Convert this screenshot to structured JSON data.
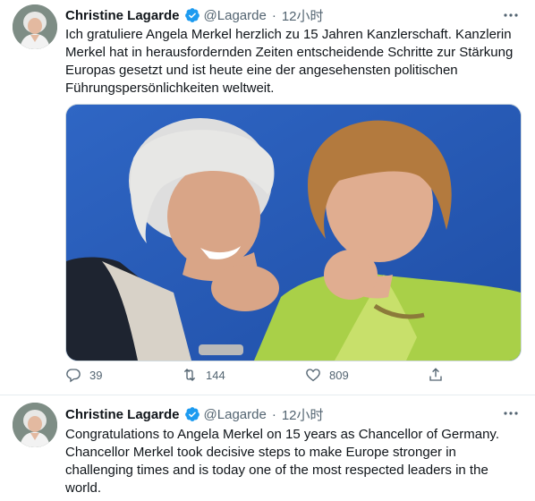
{
  "tweets": [
    {
      "name": "Christine Lagarde",
      "handle": "@Lagarde",
      "dot": "·",
      "time": "12小时",
      "text": "Ich gratuliere Angela Merkel herzlich zu 15 Jahren Kanzlerschaft. Kanzlerin Merkel hat in herausfordernden Zeiten entscheidende Schritte zur Stärkung Europas gesetzt und ist heute eine der angesehensten politischen Führungspersönlichkeiten weltweit.",
      "replies": "39",
      "retweets": "144",
      "likes": "809"
    },
    {
      "name": "Christine Lagarde",
      "handle": "@Lagarde",
      "dot": "·",
      "time": "12小时",
      "text": "Congratulations to Angela Merkel on 15 years as Chancellor of Germany. Chancellor Merkel took decisive steps to make Europe stronger in challenging times and is today one of the most respected leaders in the world."
    }
  ],
  "icons": {
    "verified": "verified-badge-icon",
    "more": "more-horizontal-icon",
    "reply": "reply-icon",
    "retweet": "retweet-icon",
    "like": "like-heart-icon",
    "share": "share-icon"
  },
  "colors": {
    "verified": "#1d9bf0",
    "muted": "#536471",
    "text": "#0f1419",
    "divider": "#e6ecf0"
  }
}
